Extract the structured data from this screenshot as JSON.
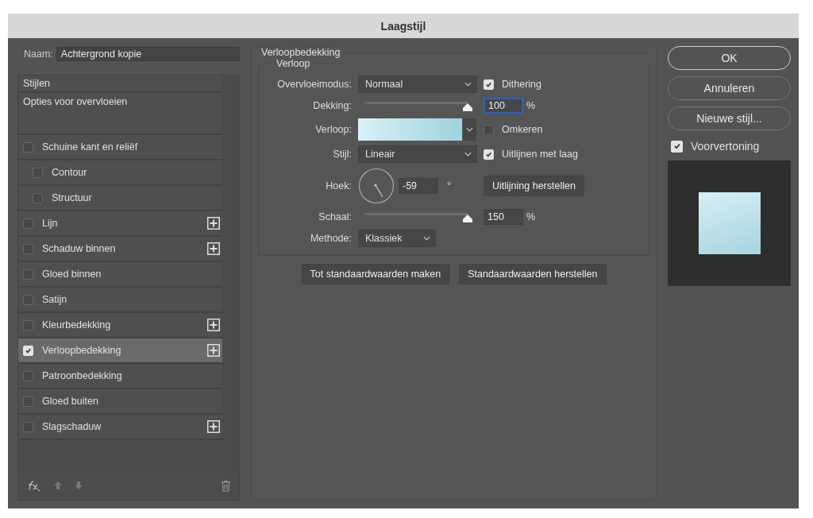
{
  "window": {
    "title": "Laagstijl"
  },
  "name_field": {
    "label": "Naam:",
    "value": "Achtergrond kopie"
  },
  "styles_list": [
    {
      "kind": "header",
      "label": "Stijlen",
      "selected": false
    },
    {
      "kind": "header",
      "label": "Opties voor overvloeien",
      "selected": false
    },
    {
      "kind": "check",
      "label": "Schuine kant en reliëf",
      "checked": false,
      "add": false,
      "selected": false,
      "children": [
        {
          "kind": "check",
          "label": "Contour",
          "checked": false,
          "add": false,
          "selected": false
        },
        {
          "kind": "check",
          "label": "Structuur",
          "checked": false,
          "add": false,
          "selected": false
        }
      ]
    },
    {
      "kind": "check",
      "label": "Lijn",
      "checked": false,
      "add": true,
      "selected": false
    },
    {
      "kind": "check",
      "label": "Schaduw binnen",
      "checked": false,
      "add": true,
      "selected": false
    },
    {
      "kind": "check",
      "label": "Gloed binnen",
      "checked": false,
      "add": false,
      "selected": false
    },
    {
      "kind": "check",
      "label": "Satijn",
      "checked": false,
      "add": false,
      "selected": false
    },
    {
      "kind": "check",
      "label": "Kleurbedekking",
      "checked": false,
      "add": true,
      "selected": false
    },
    {
      "kind": "check",
      "label": "Verloopbedekking",
      "checked": true,
      "add": true,
      "selected": true
    },
    {
      "kind": "check",
      "label": "Patroonbedekking",
      "checked": false,
      "add": false,
      "selected": false
    },
    {
      "kind": "check",
      "label": "Gloed buiten",
      "checked": false,
      "add": false,
      "selected": false
    },
    {
      "kind": "check",
      "label": "Slagschaduw",
      "checked": false,
      "add": true,
      "selected": false
    }
  ],
  "panel": {
    "title": "Verloopbedekking",
    "group": "Verloop",
    "blend_mode": {
      "label": "Overvloeimodus:",
      "value": "Normaal"
    },
    "dithering": {
      "label": "Dithering",
      "checked": true
    },
    "opacity": {
      "label": "Dekking:",
      "level": 1.0,
      "value": "100",
      "unit": "%"
    },
    "gradient": {
      "label": "Verloop:"
    },
    "reverse": {
      "label": "Omkeren",
      "checked": false
    },
    "style": {
      "label": "Stijl:",
      "value": "Lineair"
    },
    "align": {
      "label": "Uitlijnen met laag",
      "checked": true
    },
    "angle": {
      "label": "Hoek:",
      "value": "-59",
      "unit": "°"
    },
    "reset_align": "Uitlijning herstellen",
    "scale": {
      "label": "Schaal:",
      "level": 1.0,
      "value": "150",
      "unit": "%"
    },
    "method": {
      "label": "Methode:",
      "value": "Klassiek"
    },
    "buttons": [
      "Tot standaardwaarden maken",
      "Standaardwaarden herstellen"
    ]
  },
  "actions": [
    {
      "label": "OK",
      "default": true
    },
    {
      "label": "Annuleren",
      "default": false
    },
    {
      "label": "Nieuwe stijl...",
      "default": false
    }
  ],
  "preview": {
    "label": "Voorvertoning",
    "checked": true
  }
}
